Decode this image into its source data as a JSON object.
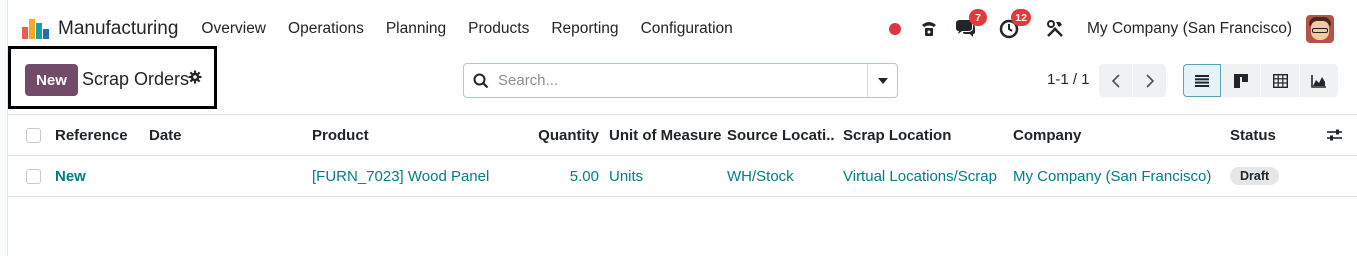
{
  "app": {
    "name": "Manufacturing",
    "logo_colors": [
      "#f05a4f",
      "#f9a825",
      "#1aa0a8",
      "#1f6fb5"
    ]
  },
  "menu": [
    "Overview",
    "Operations",
    "Planning",
    "Products",
    "Reporting",
    "Configuration"
  ],
  "systray": {
    "messages_count": "7",
    "activities_count": "12",
    "company": "My Company (San Francisco)"
  },
  "control_panel": {
    "new_label": "New",
    "title": "Scrap Orders",
    "search_placeholder": "Search...",
    "pager": "1-1 / 1",
    "views": [
      "list-view-icon",
      "kanban-view-icon",
      "pivot-view-icon",
      "graph-view-icon"
    ],
    "active_view": "list-view-icon"
  },
  "table": {
    "columns": [
      "Reference",
      "Date",
      "Product",
      "Quantity",
      "Unit of Measure",
      "Source Locati...",
      "Scrap Location",
      "Company",
      "Status"
    ],
    "rows": [
      {
        "reference": "New",
        "date": "",
        "product": "[FURN_7023] Wood Panel",
        "quantity": "5.00",
        "uom": "Units",
        "source_location": "WH/Stock",
        "scrap_location": "Virtual Locations/Scrap",
        "company": "My Company (San Francisco)",
        "status": "Draft"
      }
    ]
  },
  "colors": {
    "primary": "#714b67",
    "link": "#017e84",
    "badge": "#e4393c"
  }
}
